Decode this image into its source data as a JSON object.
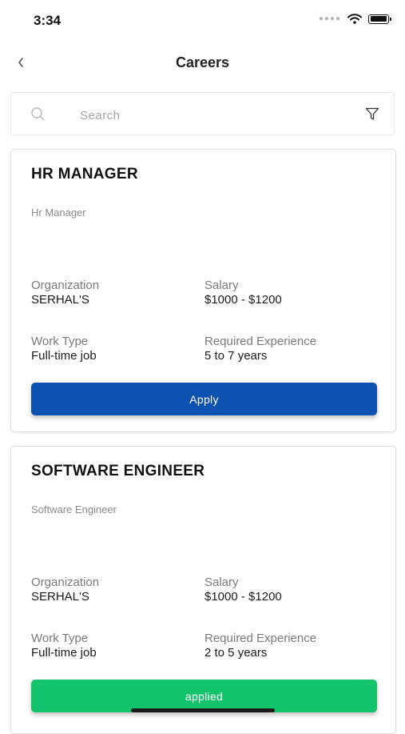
{
  "status_bar": {
    "time": "3:34",
    "signal_icon": "signal-dots-icon",
    "wifi_icon": "wifi-icon",
    "battery_icon": "battery-icon"
  },
  "header": {
    "title": "Careers",
    "back_icon": "chevron-left-icon"
  },
  "search": {
    "placeholder": "Search",
    "value": "",
    "search_icon": "magnifier-icon",
    "filter_icon": "filter-funnel-icon"
  },
  "jobs": [
    {
      "title": "HR MANAGER",
      "subtitle": "Hr Manager",
      "organization_label": "Organization",
      "organization": "SERHAL'S",
      "salary_label": "Salary",
      "salary": "$1000 - $1200",
      "work_type_label": "Work Type",
      "work_type": "Full-time job",
      "experience_label": "Required Experience",
      "experience": "5 to 7 years",
      "action_label": "Apply",
      "action_color": "#0d52b0"
    },
    {
      "title": "SOFTWARE ENGINEER",
      "subtitle": "Software Engineer",
      "organization_label": "Organization",
      "organization": "SERHAL'S",
      "salary_label": "Salary",
      "salary": "$1000 - $1200",
      "work_type_label": "Work Type",
      "work_type": "Full-time job",
      "experience_label": "Required Experience",
      "experience": "2 to 5 years",
      "action_label": "applied",
      "action_color": "#11c46b"
    }
  ]
}
